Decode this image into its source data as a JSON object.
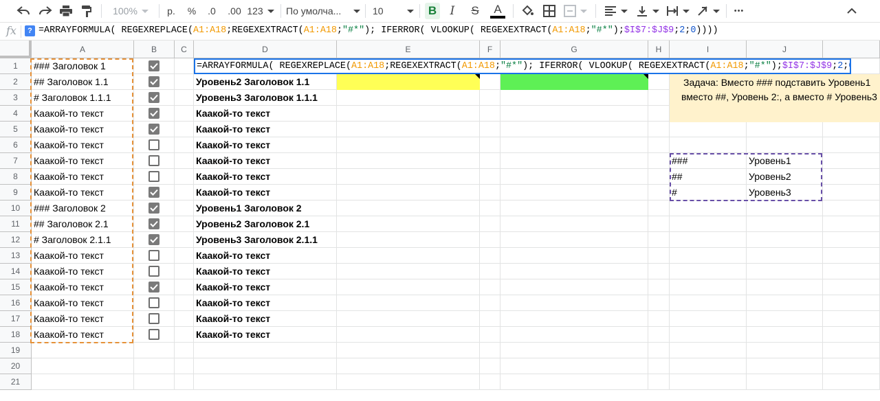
{
  "toolbar": {
    "zoom": "100%",
    "currency": "р.",
    "percent": "%",
    "dec_decrease": ".0",
    "dec_increase": ".00",
    "more_formats": "123",
    "font": "По умолча...",
    "font_size": "10",
    "bold": "B",
    "italic": "I",
    "strike": "S",
    "text_color": "A",
    "more": "•••"
  },
  "formula_bar": {
    "fx": "fx",
    "help": "?",
    "parts": [
      "=ARRAYFORMULA( REGEXREPLACE(",
      "A1:A18",
      ";REGEXEXTRACT(",
      "A1:A18",
      ";",
      "\"#*\"",
      "); IFERROR( VLOOKUP( REGEXEXTRACT(",
      "A1:A18",
      ";",
      "\"#*\"",
      ");",
      "$I$7:$J$9",
      ";",
      "2",
      ";",
      "0",
      "))))"
    ]
  },
  "columns": [
    "A",
    "B",
    "C",
    "D",
    "E",
    "F",
    "G",
    "H",
    "I",
    "J"
  ],
  "rows": [
    "1",
    "2",
    "3",
    "4",
    "5",
    "6",
    "7",
    "8",
    "9",
    "10",
    "11",
    "12",
    "13",
    "14",
    "15",
    "16",
    "17",
    "18",
    "19",
    "20",
    "21"
  ],
  "col_a": [
    "### Заголовок 1",
    "## Заголовок 1.1",
    "# Заголовок 1.1.1",
    "Каакой-то текст",
    "Каакой-то текст",
    "Каакой-то текст",
    "Каакой-то текст",
    "Каакой-то текст",
    "Каакой-то текст",
    "### Заголовок 2",
    "## Заголовок 2.1",
    "# Заголовок 2.1.1",
    "Каакой-то текст",
    "Каакой-то текст",
    "Каакой-то текст",
    "Каакой-то текст",
    "Каакой-то текст",
    "Каакой-то текст"
  ],
  "col_b_checked": [
    true,
    true,
    true,
    true,
    true,
    false,
    false,
    false,
    true,
    true,
    true,
    true,
    false,
    false,
    true,
    false,
    false,
    false
  ],
  "col_d": [
    "",
    "Уровень2 Заголовок 1.1",
    "Уровень3 Заголовок 1.1.1",
    "Каакой-то текст",
    "Каакой-то текст",
    "Каакой-то текст",
    "Каакой-то текст",
    "Каакой-то текст",
    "Каакой-то текст",
    "Уровень1 Заголовок 2",
    "Уровень2 Заголовок 2.1",
    "Уровень3 Заголовок 2.1.1",
    "Каакой-то текст",
    "Каакой-то текст",
    "Каакой-то текст",
    "Каакой-то текст",
    "Каакой-то текст",
    "Каакой-то текст"
  ],
  "note": {
    "line1": "Задача: Вместо ### подставить Уровень1",
    "line2": "вместо ##, Уровень 2:, а вместо # Уровень3"
  },
  "lookup": [
    {
      "key": "###",
      "value": "Уровень1"
    },
    {
      "key": "##",
      "value": "Уровень2"
    },
    {
      "key": "#",
      "value": "Уровень3"
    }
  ],
  "colors": {
    "yellow_fill": "#ffff56",
    "green_fill": "#5ef055",
    "note_fill": "#fff2cc",
    "range_a_border": "#e69138",
    "range_ij_border": "#674ea7",
    "active_cell_border": "#1a73e8"
  }
}
